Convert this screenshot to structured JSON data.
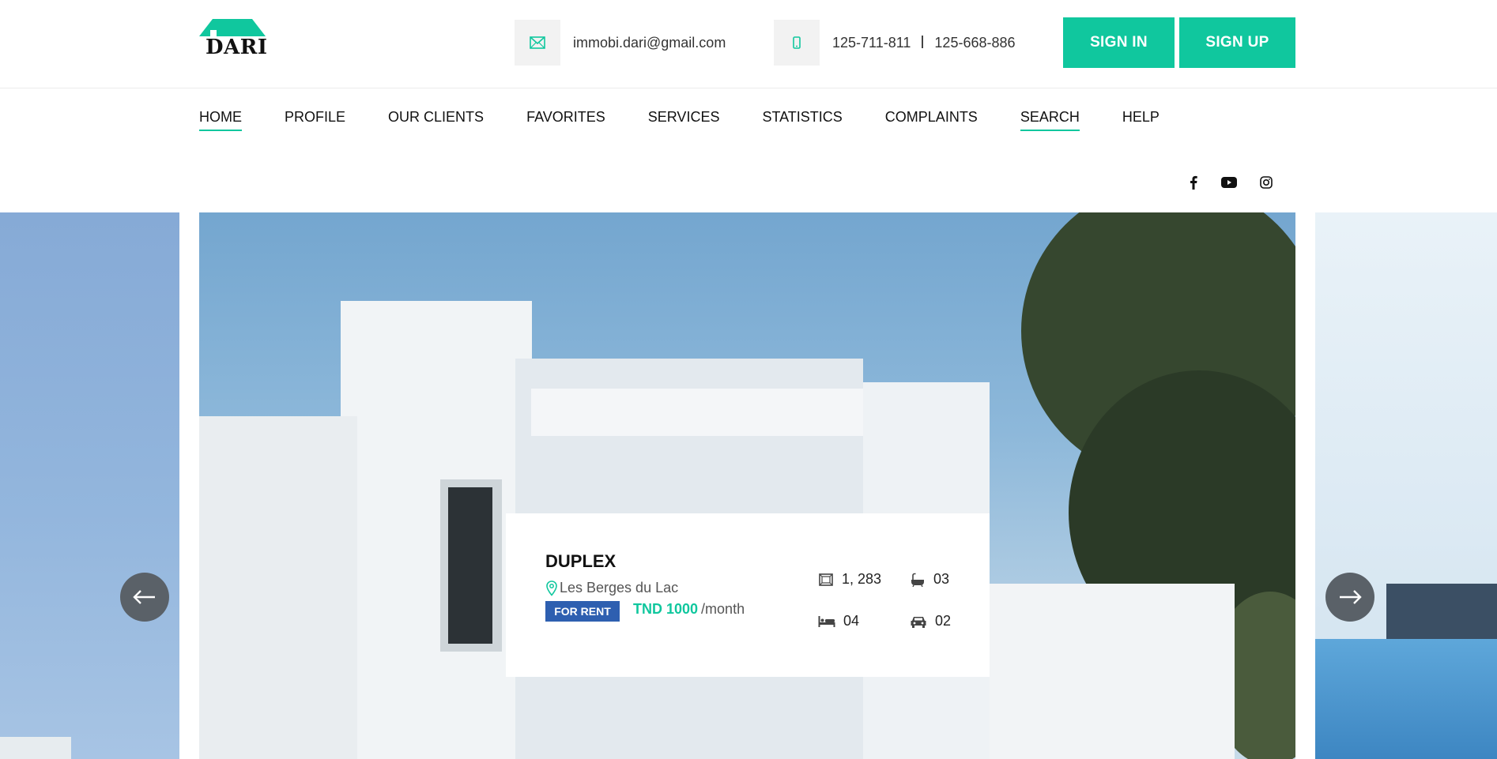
{
  "brand": {
    "name": "DARI",
    "accent_color": "#10c79e"
  },
  "contact": {
    "email": "immobi.dari@gmail.com",
    "phone_1": "125-711-811",
    "phone_2": "125-668-886"
  },
  "auth": {
    "sign_in": "SIGN IN",
    "sign_up": "SIGN UP"
  },
  "nav": {
    "items": [
      {
        "label": "HOME",
        "active": true
      },
      {
        "label": "PROFILE",
        "active": false
      },
      {
        "label": "OUR CLIENTS",
        "active": false
      },
      {
        "label": "FAVORITES",
        "active": false
      },
      {
        "label": "SERVICES",
        "active": false
      },
      {
        "label": "STATISTICS",
        "active": false
      },
      {
        "label": "COMPLAINTS",
        "active": false
      },
      {
        "label": "SEARCH",
        "active": true
      },
      {
        "label": "HELP",
        "active": false
      }
    ]
  },
  "social": [
    "facebook-icon",
    "youtube-icon",
    "instagram-icon"
  ],
  "listing": {
    "title": "DUPLEX",
    "location": "Les Berges du Lac",
    "badge": "FOR RENT",
    "badge_color": "#2e5fb0",
    "price": "TND 1000",
    "price_unit": "/month",
    "area": "1, 283",
    "baths": "03",
    "beds": "04",
    "garage": "02"
  }
}
